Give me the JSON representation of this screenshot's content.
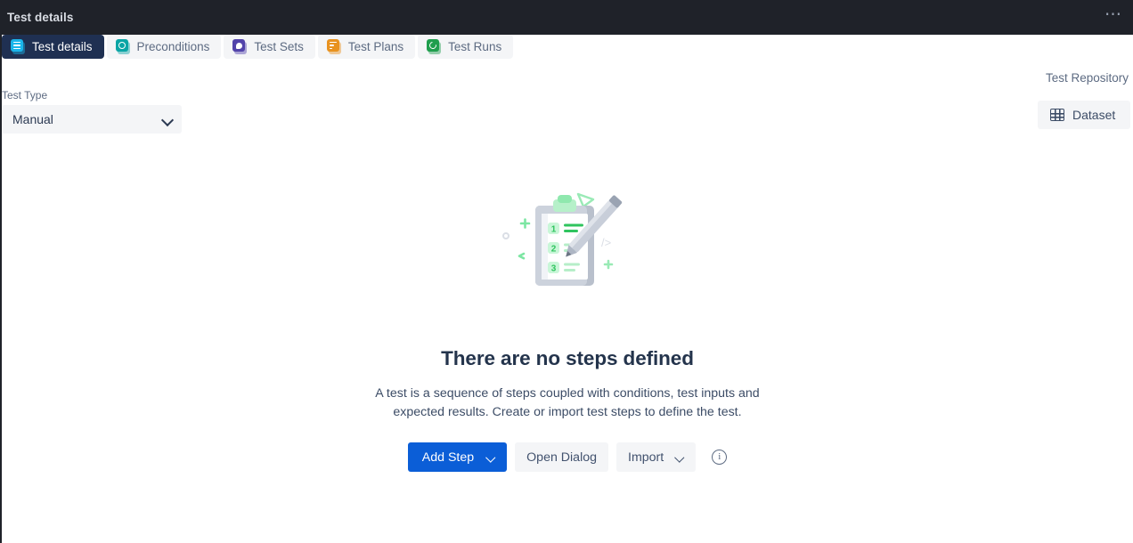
{
  "window": {
    "title": "Test details",
    "more_menu": "⋯"
  },
  "tabs": [
    {
      "label": "Test details",
      "icon": "list-icon",
      "icon_color": "#1ab5ea",
      "active": true
    },
    {
      "label": "Preconditions",
      "icon": "precondition-icon",
      "icon_color": "#0aa5a5",
      "active": false
    },
    {
      "label": "Test Sets",
      "icon": "test-set-icon",
      "icon_color": "#5243aa",
      "active": false
    },
    {
      "label": "Test Plans",
      "icon": "test-plan-icon",
      "icon_color": "#e8921f",
      "active": false
    },
    {
      "label": "Test Runs",
      "icon": "test-run-icon",
      "icon_color": "#1f9e4d",
      "active": false
    }
  ],
  "test_type": {
    "label": "Test Type",
    "value": "Manual",
    "chevron": "chevron-down-icon"
  },
  "right_panel": {
    "repository_label": "Test Repository",
    "dataset_button": "Dataset",
    "dataset_icon": "grid-icon"
  },
  "empty_state": {
    "illustration": "clipboard-checklist-pencil-illustration",
    "title": "There are no steps defined",
    "description": "A test is a sequence of steps coupled with conditions, test inputs and expected results. Create or import test steps to define the test.",
    "steps": [
      "1",
      "2",
      "3"
    ]
  },
  "actions": {
    "add_step": "Add Step",
    "add_step_chevron": "chevron-down-icon",
    "open_dialog": "Open Dialog",
    "import": "Import",
    "import_chevron": "chevron-down-icon",
    "info": "i"
  },
  "colors": {
    "topbar": "#1f2229",
    "primary": "#0b5ed7",
    "active_tab": "#1f3052",
    "subtle": "#f4f5f7",
    "text": "#3c4c66",
    "heading": "#24344c",
    "accent_green": "#4fd67f"
  }
}
